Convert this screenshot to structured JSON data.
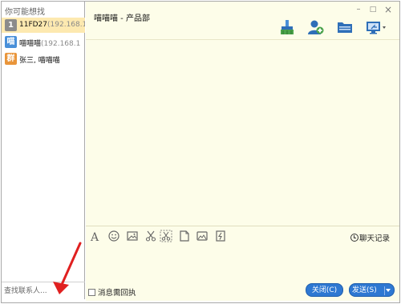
{
  "left_pane": {
    "heading": "你可能想找",
    "contacts": [
      {
        "badge": "1",
        "badge_color": "#8b8b8b",
        "name": "11FD27",
        "ip": "(192.168.1",
        "selected": true
      },
      {
        "badge": "喵",
        "badge_color": "#4a90d9",
        "name": "喵喵喵",
        "ip": "(192.168.1",
        "selected": false
      },
      {
        "badge": "群",
        "badge_color": "#e9953a",
        "name": "张三, 喵喵喵",
        "ip": "",
        "selected": false
      }
    ],
    "search_placeholder": "查找联系人..."
  },
  "chat": {
    "title": "喵喵喵 - 产品部",
    "window_controls": {
      "minimize": "–",
      "maximize": "□",
      "close": "×"
    },
    "toolbar_icons": [
      "broom-icon",
      "add-contact-icon",
      "folder-icon",
      "screen-share-icon"
    ],
    "format_icons": [
      "font-icon",
      "emoji-icon",
      "image-icon",
      "cut-icon",
      "screenshot-cut-icon",
      "file-icon",
      "picture-folder-icon",
      "shake-icon"
    ],
    "history_label": "聊天记录",
    "receipt_label": "消息需回执",
    "close_button": "关闭(C)",
    "send_button": "发送(S)"
  },
  "colors": {
    "selected_row": "#fde9b0",
    "chat_background": "#fdfde9",
    "button_blue": "#2e78d2",
    "arrow_red": "#e02020"
  }
}
